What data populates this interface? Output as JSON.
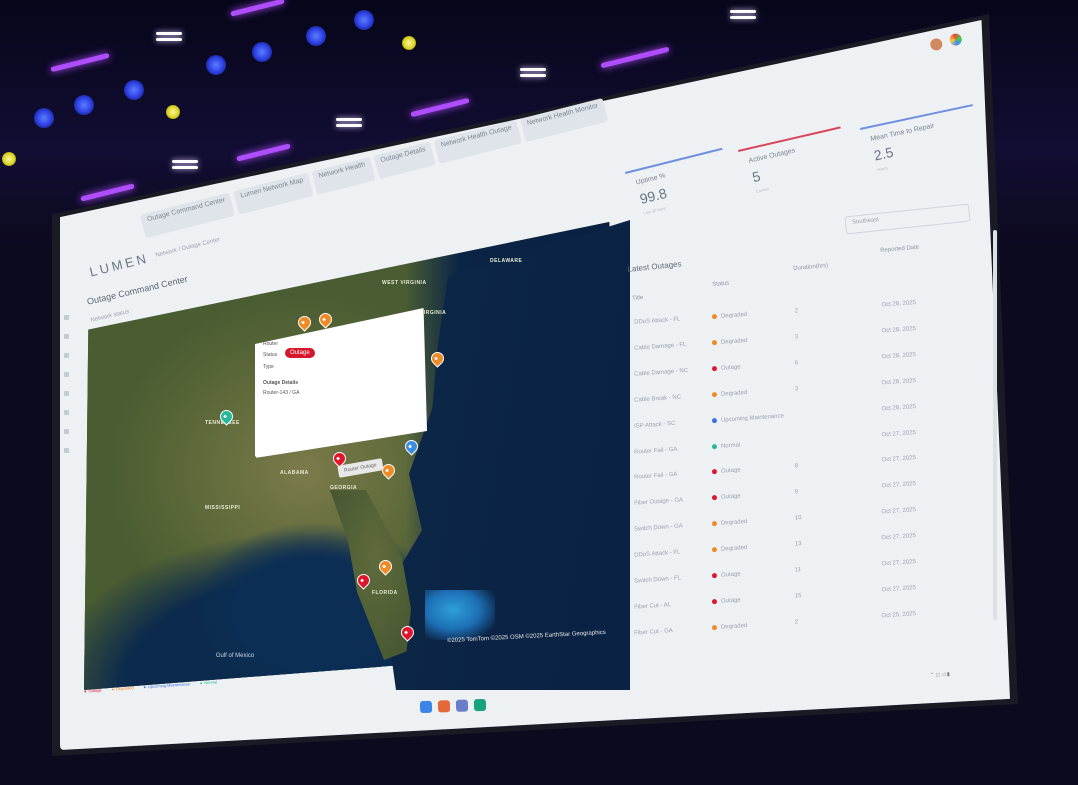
{
  "browser": {
    "tabs": [
      "Outage Command Center",
      "Lumen Network Map",
      "Network Health",
      "Outage Details",
      "Network Health Outage",
      "Network Health Monitor"
    ]
  },
  "app": {
    "logo": "LUMEN",
    "breadcrumb": "Network / Outage Center",
    "title": "Outage Command Center",
    "subtitle": "Network status"
  },
  "map": {
    "popup": {
      "heading": "Router",
      "status_label": "Status",
      "status_value": "Outage",
      "type_label": "Type",
      "details_heading": "Outage Details",
      "router_line": "Router-143 / GA"
    },
    "hover_label": "Router Outage",
    "copyright": "©2025 TomTom ©2025 OSM ©2025 EarthStar Geographics",
    "gulf_label": "Gulf of Mexico",
    "state_labels": [
      "WEST VIRGINIA",
      "VIRGINIA",
      "DELAWARE",
      "TENNESSEE",
      "ALABAMA",
      "GEORGIA",
      "FLORIDA",
      "MISSISSIPPI"
    ],
    "legend": [
      "Outage",
      "Degraded",
      "Upcoming Maintenance",
      "Normal"
    ]
  },
  "kpis": [
    {
      "label": "Uptime %",
      "value": "99.8",
      "sub": "Last 30 days",
      "color": "#6f8fe0"
    },
    {
      "label": "Active Outages",
      "value": "5",
      "sub": "Current",
      "color": "#d9455a"
    },
    {
      "label": "Mean Time to Repair",
      "value": "2.5",
      "sub": "Hours",
      "color": "#6f8fe0"
    }
  ],
  "dropdown": "Southeast",
  "table": {
    "title": "Latest Outages",
    "headers": [
      "Title",
      "Status",
      "Duration(hrs)",
      "Reported Date"
    ],
    "rows": [
      {
        "title": "DDoS Attack - FL",
        "status": "Degraded",
        "color": "#f08a24",
        "duration": "2",
        "date": "Oct 28, 2025"
      },
      {
        "title": "Cable Damage - FL",
        "status": "Degraded",
        "color": "#f08a24",
        "duration": "3",
        "date": "Oct 28, 2025"
      },
      {
        "title": "Cable Damage - NC",
        "status": "Outage",
        "color": "#e0152a",
        "duration": "6",
        "date": "Oct 28, 2025"
      },
      {
        "title": "Cable Break - NC",
        "status": "Degraded",
        "color": "#f08a24",
        "duration": "3",
        "date": "Oct 28, 2025"
      },
      {
        "title": "ISP Attack - SC",
        "status": "Upcoming Maintenance",
        "color": "#3b6fe0",
        "duration": "",
        "date": "Oct 28, 2025"
      },
      {
        "title": "Router Fail - GA",
        "status": "Normal",
        "color": "#27b79b",
        "duration": "",
        "date": "Oct 27, 2025"
      },
      {
        "title": "Router Fail - GA",
        "status": "Outage",
        "color": "#e0152a",
        "duration": "8",
        "date": "Oct 27, 2025"
      },
      {
        "title": "Fiber Outage - GA",
        "status": "Outage",
        "color": "#e0152a",
        "duration": "9",
        "date": "Oct 27, 2025"
      },
      {
        "title": "Switch Down - GA",
        "status": "Degraded",
        "color": "#f08a24",
        "duration": "10",
        "date": "Oct 27, 2025"
      },
      {
        "title": "DDoS Attack - FL",
        "status": "Degraded",
        "color": "#f08a24",
        "duration": "13",
        "date": "Oct 27, 2025"
      },
      {
        "title": "Switch Down - FL",
        "status": "Outage",
        "color": "#e0152a",
        "duration": "11",
        "date": "Oct 27, 2025"
      },
      {
        "title": "Fiber Cut - AL",
        "status": "Outage",
        "color": "#e0152a",
        "duration": "15",
        "date": "Oct 27, 2025"
      },
      {
        "title": "Fiber Cut - GA",
        "status": "Degraded",
        "color": "#f08a24",
        "duration": "2",
        "date": "Oct 25, 2025"
      }
    ]
  }
}
